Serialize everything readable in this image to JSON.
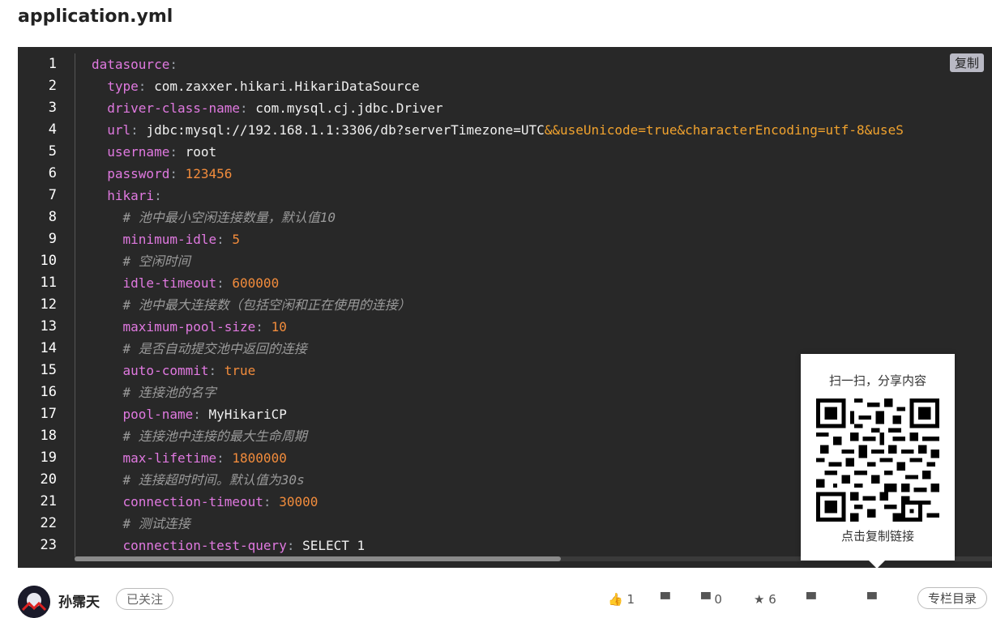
{
  "file_title": "application.yml",
  "copy_label": "复制",
  "line_numbers": [
    "1",
    "2",
    "3",
    "4",
    "5",
    "6",
    "7",
    "8",
    "9",
    "10",
    "11",
    "12",
    "13",
    "14",
    "15",
    "16",
    "17",
    "18",
    "19",
    "20",
    "21",
    "22",
    "23"
  ],
  "code": {
    "l1_key": "datasource",
    "l2_key": "  type",
    "l2_val": " com.zaxxer.hikari.HikariDataSource",
    "l3_key": "  driver-class-name",
    "l3_val": " com.mysql.cj.jdbc.Driver",
    "l4_key": "  url",
    "l4_val": " jdbc:mysql://192.168.1.1:3306/db?serverTimezone=UTC",
    "l4_tail": "&&useUnicode=true&characterEncoding=utf-8&useS",
    "l5_key": "  username",
    "l5_val": " root",
    "l6_key": "  password",
    "l6_val": " 123456",
    "l7_key": "  hikari",
    "l8_comment": "    # 池中最小空闲连接数量，默认值10",
    "l9_key": "    minimum-idle",
    "l9_val": " 5",
    "l10_comment": "    # 空闲时间",
    "l11_key": "    idle-timeout",
    "l11_val": " 600000",
    "l12_comment": "    # 池中最大连接数（包括空闲和正在使用的连接）",
    "l13_key": "    maximum-pool-size",
    "l13_val": " 10",
    "l14_comment": "    # 是否自动提交池中返回的连接",
    "l15_key": "    auto-commit",
    "l15_val": " true",
    "l16_comment": "    # 连接池的名字",
    "l17_key": "    pool-name",
    "l17_val": " MyHikariCP",
    "l18_comment": "    # 连接池中连接的最大生命周期",
    "l19_key": "    max-lifetime",
    "l19_val": " 1800000",
    "l20_comment": "    # 连接超时时间。默认值为30s",
    "l21_key": "    connection-timeout",
    "l21_val": " 30000",
    "l22_comment": "    # 测试连接",
    "l23_key": "    connection-test-query",
    "l23_val": " SELECT 1",
    "colon": ":"
  },
  "qr_popup": {
    "title": "扫一扫，分享内容",
    "link_label": "点击复制链接"
  },
  "footer": {
    "author": "孙霈天",
    "follow_label": "已关注",
    "like_count": "1",
    "comment_count": "0",
    "star_count": "6",
    "catalog_label": "专栏目录"
  }
}
